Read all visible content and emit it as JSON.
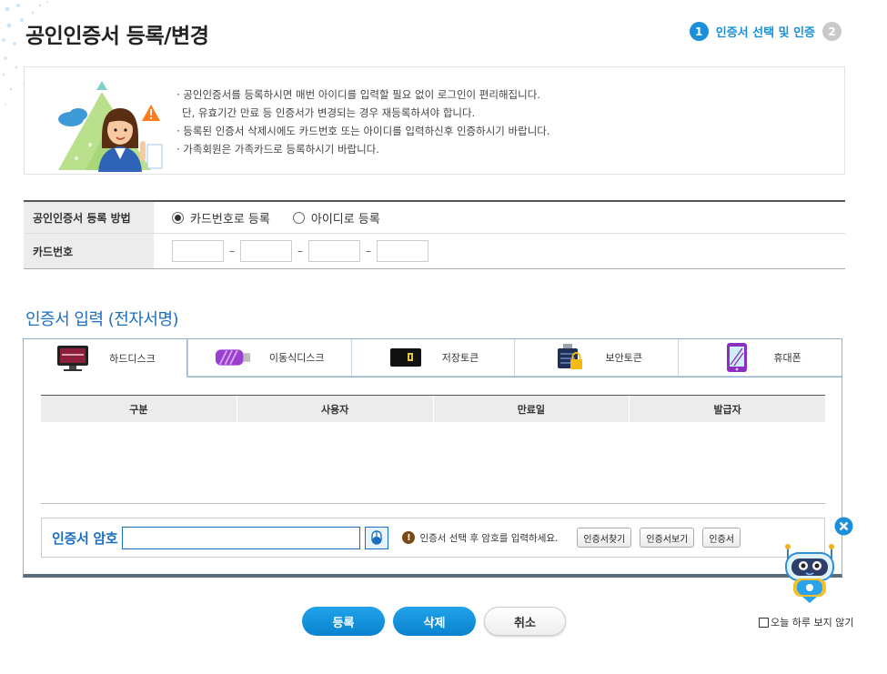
{
  "page": {
    "title": "공인인증서 등록/변경"
  },
  "steps": {
    "active_num": "1",
    "active_label": "인증서 선택 및 인증",
    "next_num": "2"
  },
  "notice": {
    "lines": [
      "· 공인인증서를 등록하시면 매번 아이디를 입력할 필요 없이 로그인이 편리해집니다.",
      "  단, 유효기간 만료 등 인증서가 변경되는 경우 재등록하셔야 합니다.",
      "· 등록된 인증서 삭제시에도 카드번호 또는 아이디를 입력하신후 인증하시기 바랍니다.",
      "· 가족회원은 가족카드로 등록하시기 바랍니다."
    ]
  },
  "registration": {
    "method_label": "공인인증서 등록 방법",
    "option_card": "카드번호로 등록",
    "option_id": "아이디로 등록",
    "selected": "card",
    "card_label": "카드번호",
    "card_sep": "–"
  },
  "cert": {
    "section_title": "인증서 입력 (전자서명)",
    "tabs": [
      {
        "label": "하드디스크",
        "icon": "monitor-icon"
      },
      {
        "label": "이동식디스크",
        "icon": "usb-drive-icon"
      },
      {
        "label": "저장토큰",
        "icon": "token-icon"
      },
      {
        "label": "보안토큰",
        "icon": "security-token-icon"
      },
      {
        "label": "휴대폰",
        "icon": "phone-icon"
      }
    ],
    "active_tab": 0,
    "columns": [
      "구분",
      "사용자",
      "만료일",
      "발급자"
    ],
    "password_label": "인증서 암호",
    "hint": "인증서 선택 후 암호를 입력하세요.",
    "hint_icon": "!",
    "find_btn": "인증서찾기",
    "view_btn": "인증서보기",
    "third_btn": "인증서"
  },
  "actions": {
    "register": "등록",
    "delete": "삭제",
    "cancel": "취소"
  },
  "popup": {
    "close_icon": "×",
    "no_show_today": "오늘 하루 보지 않기"
  },
  "colors": {
    "accent": "#1b8fd9",
    "title_blue": "#1b6fc2"
  }
}
